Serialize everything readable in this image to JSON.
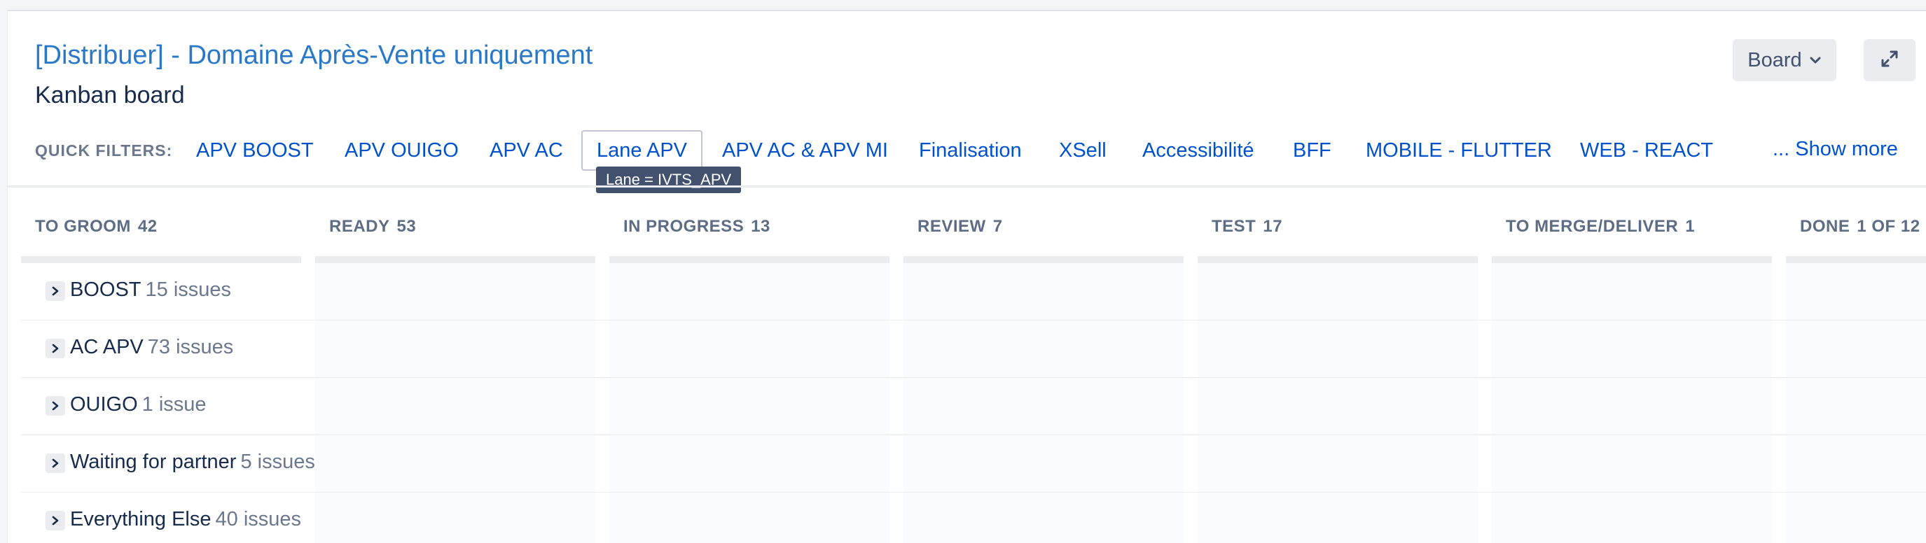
{
  "header": {
    "title": "[Distribuer] - Domaine Après-Vente uniquement",
    "subtitle": "Kanban board",
    "board_button": "Board",
    "expand_icon": "expand-icon",
    "chevron_icon": "chevron-down-icon"
  },
  "quick_filters": {
    "label": "QUICK FILTERS:",
    "items": [
      {
        "label": "APV BOOST"
      },
      {
        "label": "APV OUIGO"
      },
      {
        "label": "APV AC"
      },
      {
        "label": "Lane APV",
        "active": true
      },
      {
        "label": "APV AC & APV MI"
      },
      {
        "label": "Finalisation"
      },
      {
        "label": "XSell"
      },
      {
        "label": "Accessibilité"
      },
      {
        "label": "BFF"
      },
      {
        "label": "MOBILE - FLUTTER"
      },
      {
        "label": "WEB - REACT"
      }
    ],
    "tooltip": "Lane = IVTS_APV",
    "show_more": "... Show more"
  },
  "columns": [
    {
      "name": "TO GROOM",
      "count": "42"
    },
    {
      "name": "READY",
      "count": "53"
    },
    {
      "name": "IN PROGRESS",
      "count": "13"
    },
    {
      "name": "REVIEW",
      "count": "7"
    },
    {
      "name": "TEST",
      "count": "17"
    },
    {
      "name": "TO MERGE/DELIVER",
      "count": "1"
    },
    {
      "name": "DONE",
      "count": "1 OF 12"
    }
  ],
  "swimlanes": [
    {
      "name": "BOOST",
      "count": "15 issues"
    },
    {
      "name": "AC APV",
      "count": "73 issues"
    },
    {
      "name": "OUIGO",
      "count": "1 issue"
    },
    {
      "name": "Waiting for partner",
      "count": "5 issues"
    },
    {
      "name": "Everything Else",
      "count": "40 issues"
    }
  ],
  "colors": {
    "title": "#2a78c8",
    "link": "#0052cc",
    "muted": "#6b778c",
    "tooltip_bg": "#42526e"
  }
}
